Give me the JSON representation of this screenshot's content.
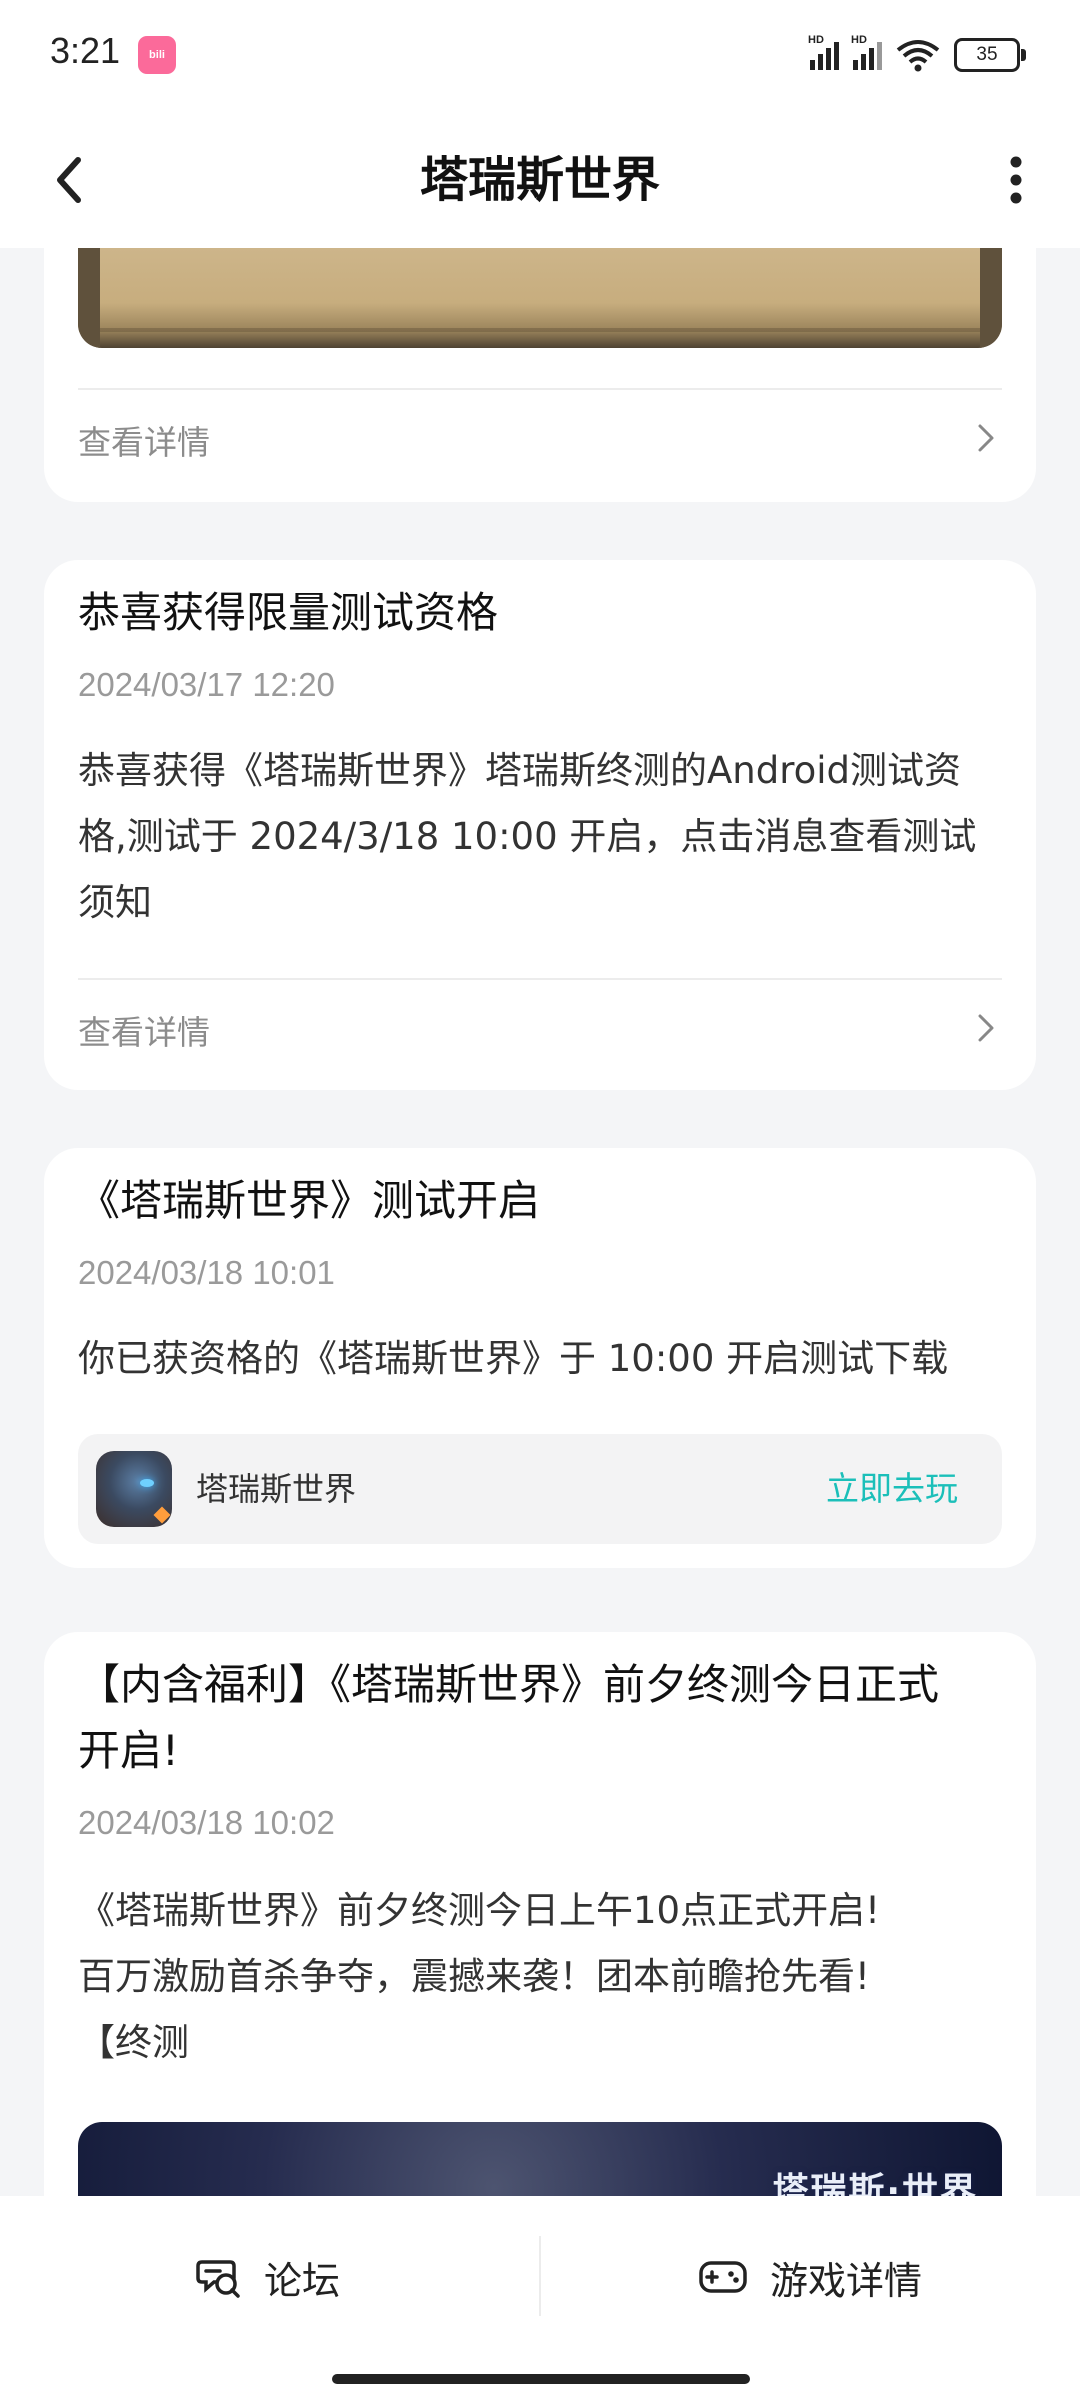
{
  "status_bar": {
    "time": "3:21",
    "app_badge": "bilibili",
    "signal1_label": "HD",
    "signal2_label": "HD",
    "battery": "35"
  },
  "header": {
    "title": "塔瑞斯世界",
    "back_icon": "chevron-left-icon",
    "more_icon": "more-vertical-icon"
  },
  "cards": [
    {
      "detail_label": "查看详情"
    },
    {
      "title": "恭喜获得限量测试资格",
      "date": "2024/03/17 12:20",
      "body": "恭喜获得《塔瑞斯世界》塔瑞斯终测的Android测试资格,测试于 2024/3/18 10:00 开启，点击消息查看测试须知",
      "detail_label": "查看详情"
    },
    {
      "title": "《塔瑞斯世界》测试开启",
      "date": "2024/03/18 10:01",
      "body": "你已获资格的《塔瑞斯世界》于 10:00 开启测试下载",
      "game_name": "塔瑞斯世界",
      "play_label": "立即去玩"
    },
    {
      "title_line1": "【内含福利】《塔瑞斯世界》前夕终测今日正式",
      "title_line2": "开启!",
      "date": "2024/03/18 10:02",
      "body_line1": "《塔瑞斯世界》前夕终测今日上午10点正式开启!",
      "body_line2": "百万激励首杀争夺，震撼来袭！团本前瞻抢先看!",
      "body_line3": "【终测",
      "banner_logo": "塔瑞斯·世界"
    }
  ],
  "bottom_bar": {
    "forum_label": "论坛",
    "game_detail_label": "游戏详情"
  },
  "colors": {
    "accent": "#1bbfb9",
    "background": "#f4f5f7"
  }
}
